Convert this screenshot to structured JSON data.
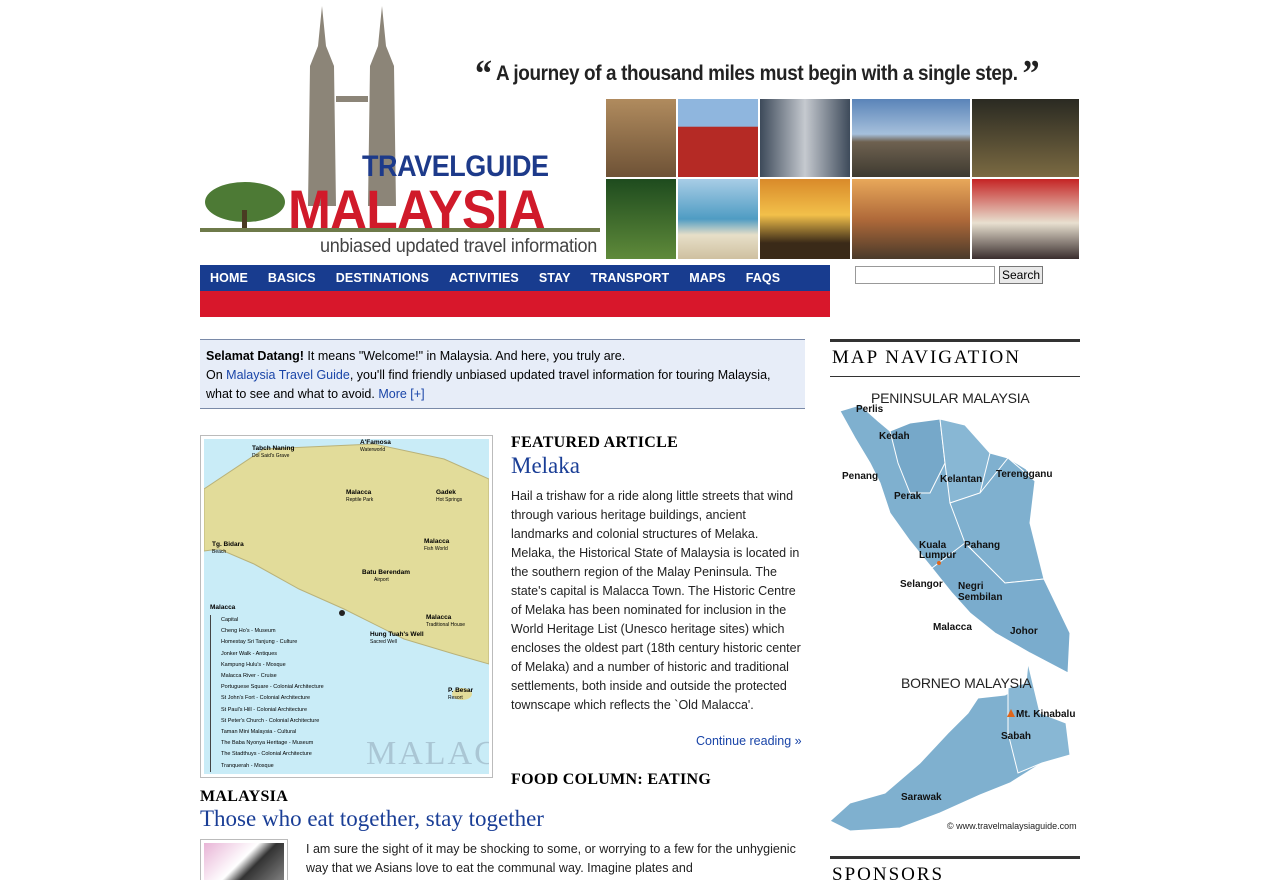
{
  "banner": {
    "logo_top": "TRAVELGUIDE",
    "logo_main": "MALAYSIA",
    "tagline": "unbiased updated travel information",
    "quote": "A journey of a thousand miles must begin with a single step."
  },
  "nav": {
    "items": [
      "HOME",
      "BASICS",
      "DESTINATIONS",
      "ACTIVITIES",
      "STAY",
      "TRANSPORT",
      "MAPS",
      "FAQS"
    ]
  },
  "search": {
    "value": "",
    "button_label": "Search"
  },
  "welcome": {
    "greeting": "Selamat Datang!",
    "line1": " It means \"Welcome!\" in Malaysia. And here, you truly are.",
    "on": "On ",
    "site_link": "Malaysia Travel Guide",
    "line2": ", you'll find friendly unbiased updated travel information for touring Malaysia, what to see and what to avoid. ",
    "more_link": "More [+]"
  },
  "featured": {
    "kicker": "FEATURED ARTICLE",
    "title": "Melaka",
    "body": "Hail a trishaw for a ride along little streets that wind through various heritage buildings, ancient landmarks and colonial structures of Melaka. Melaka, the Historical State of Malaysia is located in the southern region of the Malay Peninsula. The state's capital is Malacca Town. The Historic Centre of Melaka has been nominated for inclusion in the World Heritage List (Unesco heritage sites) which encloses the oldest part (18th century historic center of Melaka) and a number of historic and traditional settlements, both inside and outside the protected townscape which reflects the `Old Malacca'.",
    "continue_link": "Continue reading »",
    "map_labels": {
      "tabch": "Tabch Naning",
      "tabch_sub": "Dol Said's Grave",
      "afamosa": "A'Famosa",
      "afamosa_sub": "Waterworld",
      "reptile": "Malacca",
      "reptile_sub": "Reptile Park",
      "gadek": "Gadek",
      "gadek_sub": "Hot Springs",
      "bidara": "Tg. Bidara",
      "bidara_sub": "Beach",
      "fish": "Malacca",
      "fish_sub": "Fish World",
      "airport": "Batu Berendam",
      "airport_sub": "Airport",
      "malacca": "Malacca",
      "traditional": "Malacca",
      "traditional_sub": "Traditional House",
      "hangtuah": "Hung Tuah's Well",
      "hangtuah_sub": "Sacred Well",
      "pbesar": "P. Besar",
      "pbesar_sub": "Resort",
      "watermark": "MALAC",
      "legend": [
        "Capital",
        "Cheng Ho's - Museum",
        "Homestay Sri Tanjung - Culture",
        "Jonker Walk - Antiques",
        "Kampung Hulu's - Mosque",
        "Malacca River - Cruise",
        "Portuguese Square - Colonial Architecture",
        "St John's Fort - Colonial Architecture",
        "St Paul's Hill - Colonial Architecture",
        "St Peter's Church - Colonial Architecture",
        "Taman Mini Malaysia - Cultural",
        "The Baba Nyonya Heritage - Museum",
        "The Stadthuys - Colonial Architecture",
        "Tranquerah - Mosque"
      ]
    }
  },
  "food": {
    "kicker_a": "FOOD COLUMN: EATING",
    "kicker_b": "MALAYSIA",
    "title": "Those who eat together, stay together",
    "body": "I am sure the sight of it may be shocking to some, or worrying to a few for the unhygienic way that we Asians love to eat the communal way. Imagine plates and"
  },
  "sidebar": {
    "map_heading": "MAP NAVIGATION",
    "sponsors_heading": "SPONSORS",
    "peninsular": "PENINSULAR MALAYSIA",
    "borneo": "BORNEO MALAYSIA",
    "states": {
      "perlis": "Perlis",
      "kedah": "Kedah",
      "penang": "Penang",
      "perak": "Perak",
      "kelantan": "Kelantan",
      "terengganu": "Terengganu",
      "pahang": "Pahang",
      "kl": "Kuala Lumpur",
      "selangor": "Selangor",
      "negri": "Negri Sembilan",
      "malacca": "Malacca",
      "johor": "Johor",
      "kinabalu": "Mt. Kinabalu",
      "sabah": "Sabah",
      "sarawak": "Sarawak"
    },
    "copyright": "© www.travelmalaysiaguide.com"
  },
  "colors": {
    "nav_blue": "#183c8f",
    "nav_red": "#d8172b",
    "link": "#1a45a8",
    "map_state": "#7fb0cf"
  }
}
